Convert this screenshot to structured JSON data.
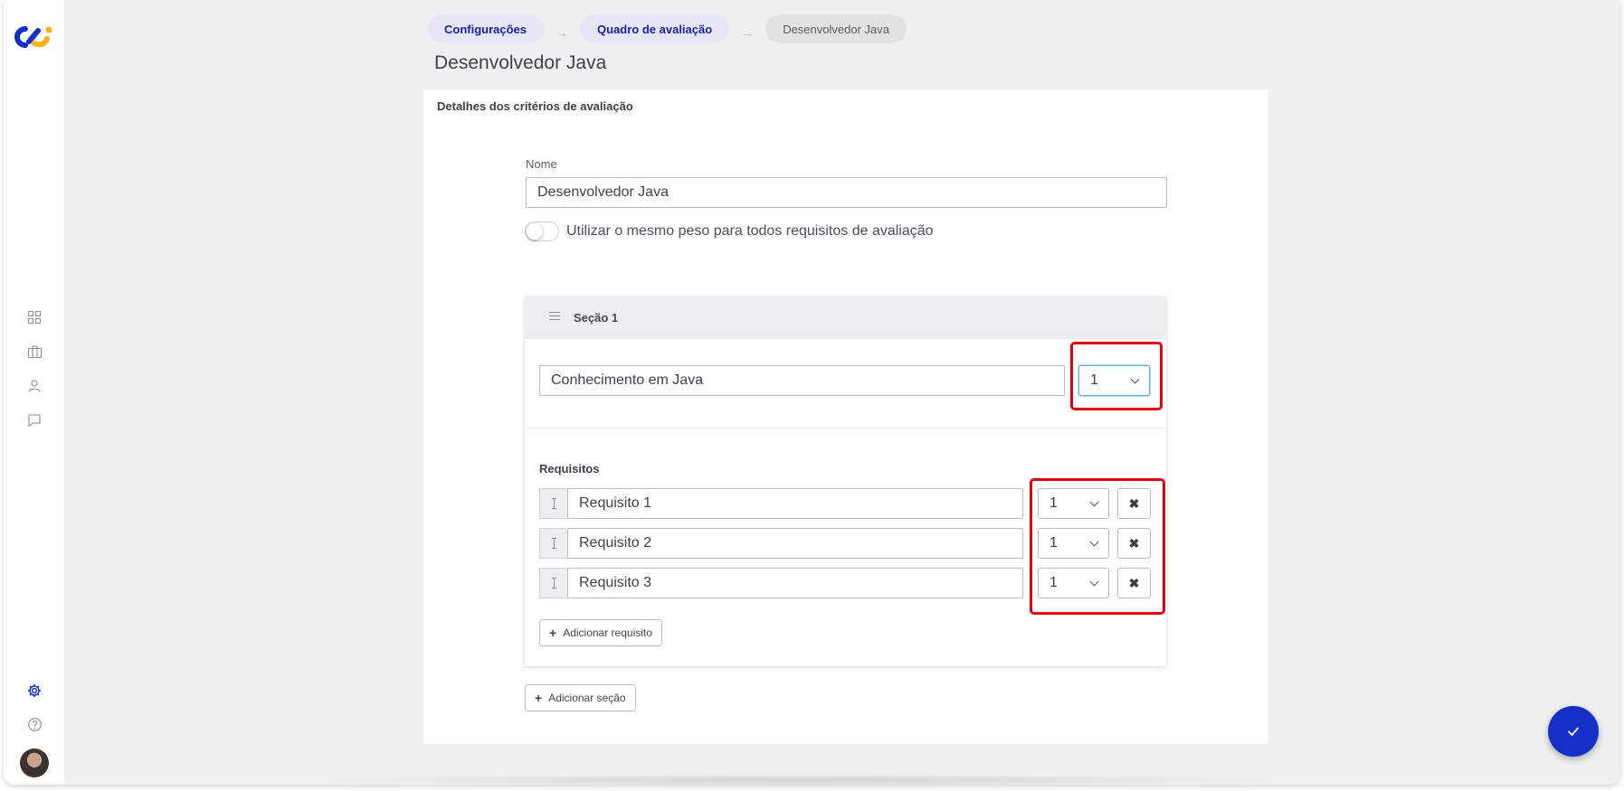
{
  "app": {
    "logo": "cs-logo",
    "nav_icons": [
      "grid-icon",
      "briefcase-icon",
      "user-icon",
      "chat-icon",
      "gear-icon",
      "help-icon"
    ],
    "accent_color": "#1b1fa6",
    "fab_color": "#1530c8",
    "highlight_color": "#e1000f"
  },
  "breadcrumb": {
    "items": [
      "Configurações",
      "Quadro de avaliação",
      "Desenvolvedor Java"
    ],
    "separator": "→"
  },
  "page": {
    "title": "Desenvolvedor Java"
  },
  "card": {
    "title": "Detalhes dos critérios de avaliação",
    "name_label": "Nome",
    "name_value": "Desenvolvedor Java",
    "toggle_label": "Utilizar o mesmo peso para todos requisitos de avaliação",
    "toggle_on": false
  },
  "section": {
    "title": "Seção 1",
    "criterion_value": "Conhecimento em Java",
    "criterion_weight": "1",
    "requirements_label": "Requisitos",
    "requirements": [
      {
        "name": "Requisito 1",
        "weight": "1",
        "remove": "✖"
      },
      {
        "name": "Requisito 2",
        "weight": "1",
        "remove": "✖"
      },
      {
        "name": "Requisito 3",
        "weight": "1",
        "remove": "✖"
      }
    ],
    "add_requirement": "Adicionar requisito",
    "add_symbol": "+"
  },
  "add_section": "Adicionar seção",
  "fab_icon": "check-icon"
}
